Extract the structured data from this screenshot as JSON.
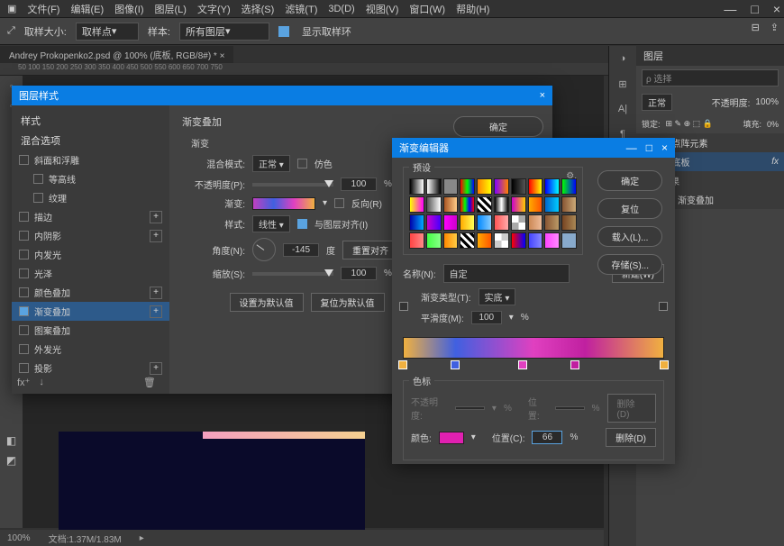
{
  "menu": [
    "文件(F)",
    "编辑(E)",
    "图像(I)",
    "图层(L)",
    "文字(Y)",
    "选择(S)",
    "滤镜(T)",
    "3D(D)",
    "视图(V)",
    "窗口(W)",
    "帮助(H)"
  ],
  "optbar": {
    "samplesize": "取样大小:",
    "sampleval": "取样点",
    "sample": "样本:",
    "sampleval2": "所有图层",
    "showring": "显示取样环"
  },
  "doctab": "Andrey Prokopenko2.psd @ 100% (底板, RGB/8#) *",
  "status": {
    "zoom": "100%",
    "doc": "文档:1.37M/1.83M"
  },
  "layers": {
    "title": "图层",
    "search": "ρ 选择",
    "normal": "正常",
    "opacity": "不透明度:",
    "opval": "100%",
    "lock": "锁定:",
    "fill": "填充:",
    "fillval": "0%",
    "items": [
      "点阵元素",
      "底板"
    ],
    "fx": "fx",
    "effects": "效果",
    "gradoverlay": "渐变叠加"
  },
  "dlg1": {
    "title": "图层样式",
    "ok": "确定",
    "styles_hdr": "样式",
    "blend_hdr": "混合选项",
    "list": [
      "斜面和浮雕",
      "等高线",
      "纹理",
      "描边",
      "内阴影",
      "内发光",
      "光泽",
      "颜色叠加",
      "渐变叠加",
      "图案叠加",
      "外发光",
      "投影"
    ],
    "gtitle": "渐变叠加",
    "gsub": "渐变",
    "blendmode": "混合模式:",
    "normal": "正常",
    "dither": "仿色",
    "opacity": "不透明度(P):",
    "opval": "100",
    "pct": "%",
    "gradient": "渐变:",
    "reverse": "反向(R)",
    "style": "样式:",
    "linear": "线性",
    "align": "与图层对齐(I)",
    "angle": "角度(N):",
    "angval": "-145",
    "deg": "度",
    "reset_align": "重置对齐",
    "scale": "缩放(S):",
    "scaleval": "100",
    "makedef": "设置为默认值",
    "resetdef": "复位为默认值"
  },
  "dlg2": {
    "title": "渐变编辑器",
    "presets": "预设",
    "ok": "确定",
    "cancel": "复位",
    "load": "载入(L)...",
    "save": "存储(S)...",
    "new": "新建(W)",
    "name": "名称(N):",
    "nameval": "自定",
    "gtype": "渐变类型(T):",
    "solid": "实底",
    "smooth": "平滑度(M):",
    "smoothval": "100",
    "pct": "%",
    "colorstop": "色标",
    "opacity": "不透明度:",
    "location": "位置:",
    "delete": "删除(D)",
    "color": "颜色:",
    "location2": "位置(C):",
    "locval": "66",
    "delete2": "删除(D)"
  },
  "presets_sw": [
    "linear-gradient(90deg,#000,#fff)",
    "linear-gradient(90deg,#fff,#000)",
    "#888",
    "linear-gradient(90deg,#f00,#0f0,#00f)",
    "linear-gradient(90deg,#ff8000,#ffff00)",
    "linear-gradient(90deg,#8000ff,#ff8000)",
    "linear-gradient(90deg,#000,#555)",
    "linear-gradient(90deg,#f00,#ff0)",
    "linear-gradient(90deg,#00f,#0ff)",
    "linear-gradient(90deg,#0f0,#00f)",
    "linear-gradient(90deg,#ff0,#f0f)",
    "linear-gradient(90deg,#555,#fff)",
    "linear-gradient(90deg,#a52,#fc8)",
    "linear-gradient(90deg,#f00,#0f0,#00f,#f00)",
    "repeating-linear-gradient(45deg,#000 0 3px,#fff 3px 6px)",
    "linear-gradient(90deg,#000,#fff,#000)",
    "linear-gradient(90deg,#c0c,#fc0)",
    "linear-gradient(90deg,#fa0,#f50)",
    "linear-gradient(90deg,#06c,#0cf)",
    "linear-gradient(90deg,#853,#ca7)",
    "linear-gradient(90deg,#00a,#0af)",
    "linear-gradient(90deg,#c0c,#40f)",
    "linear-gradient(90deg,#f0f,#c0c)",
    "linear-gradient(90deg,#fa0,#ff5)",
    "linear-gradient(90deg,#08f,#8cf)",
    "linear-gradient(90deg,#f55,#faa)",
    "repeating-conic-gradient(#aaa 0 25%,#fff 0 50%)",
    "linear-gradient(90deg,#c85,#eb9)",
    "linear-gradient(90deg,#853,#b96)",
    "linear-gradient(90deg,#742,#a85)",
    "linear-gradient(90deg,#f44,#f88)",
    "linear-gradient(90deg,#4f4,#8f8)",
    "linear-gradient(90deg,#f80,#fc4)",
    "repeating-linear-gradient(45deg,#000 0 3px,#fff 3px 6px)",
    "linear-gradient(90deg,#fa0,#f50)",
    "repeating-conic-gradient(#ccc 0 25%,#fff 0 50%)",
    "linear-gradient(90deg,#f00,#00f)",
    "linear-gradient(90deg,#44f,#88f)",
    "linear-gradient(90deg,#f4f,#f8f)",
    "#8ac"
  ],
  "grad_stops": [
    {
      "pos": 0,
      "color": "#f0b040"
    },
    {
      "pos": 20,
      "color": "#4060e0"
    },
    {
      "pos": 46,
      "color": "#e040c0"
    },
    {
      "pos": 66,
      "color": "#c020a0"
    },
    {
      "pos": 100,
      "color": "#f0b040"
    }
  ]
}
